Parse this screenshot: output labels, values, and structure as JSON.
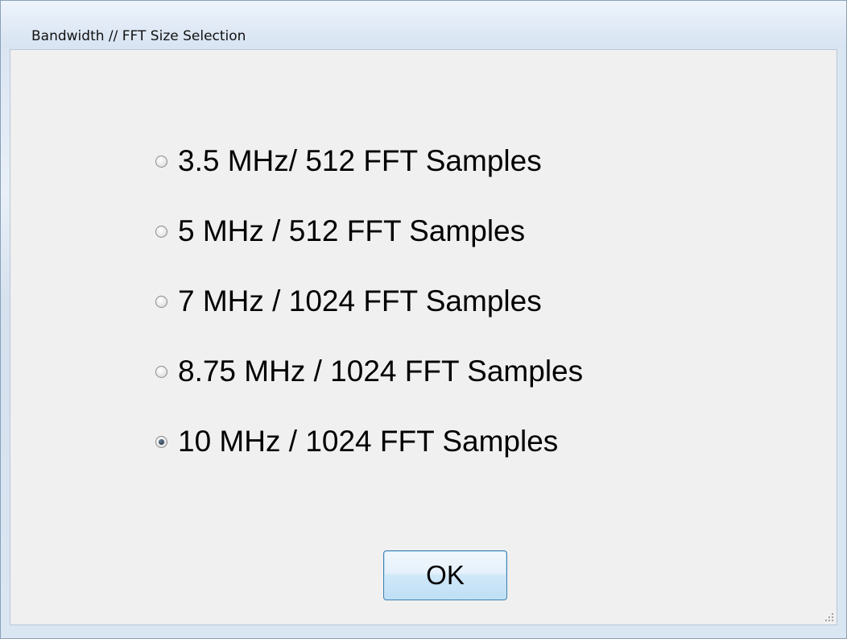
{
  "window": {
    "title": "Bandwidth // FFT Size Selection"
  },
  "options": [
    {
      "label": "3.5 MHz/ 512 FFT Samples",
      "selected": false
    },
    {
      "label": "5 MHz / 512 FFT Samples",
      "selected": false
    },
    {
      "label": "7 MHz / 1024 FFT Samples",
      "selected": false
    },
    {
      "label": "8.75 MHz / 1024 FFT Samples",
      "selected": false
    },
    {
      "label": "10 MHz / 1024 FFT Samples",
      "selected": true
    }
  ],
  "buttons": {
    "ok_label": "OK"
  },
  "colors": {
    "client_background": "#f0f0f0",
    "frame": "#dbe6f3",
    "button_border": "#3c7fb1"
  },
  "icons": {
    "resize": "resize-grip-icon"
  }
}
